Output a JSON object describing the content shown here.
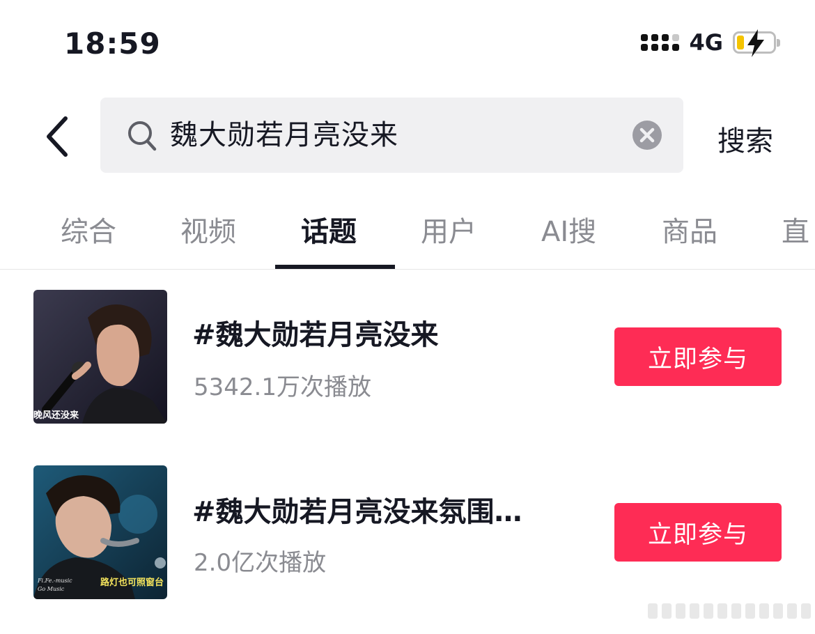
{
  "status_bar": {
    "time": "18:59",
    "network": "4G",
    "battery_level": 0.2,
    "battery_charging": true
  },
  "search": {
    "query": "魏大勋若月亮没来",
    "submit_label": "搜索"
  },
  "tabs": [
    {
      "label": "综合",
      "active": false
    },
    {
      "label": "视频",
      "active": false
    },
    {
      "label": "话题",
      "active": true
    },
    {
      "label": "用户",
      "active": false
    },
    {
      "label": "AI搜",
      "active": false
    },
    {
      "label": "商品",
      "active": false
    },
    {
      "label": "直",
      "active": false
    }
  ],
  "results": [
    {
      "title": "#魏大勋若月亮没来",
      "plays": "5342.1万次播放",
      "button": "立即参与",
      "thumb_caption": "晚风还没来"
    },
    {
      "title": "#魏大勋若月亮没来氛围…",
      "plays": "2.0亿次播放",
      "button": "立即参与",
      "thumb_caption": "路灯也可照窗台"
    }
  ],
  "colors": {
    "accent": "#fe2c55",
    "text_primary": "#161823",
    "text_secondary": "#8a8b91",
    "search_bg": "#f0f0f2"
  }
}
